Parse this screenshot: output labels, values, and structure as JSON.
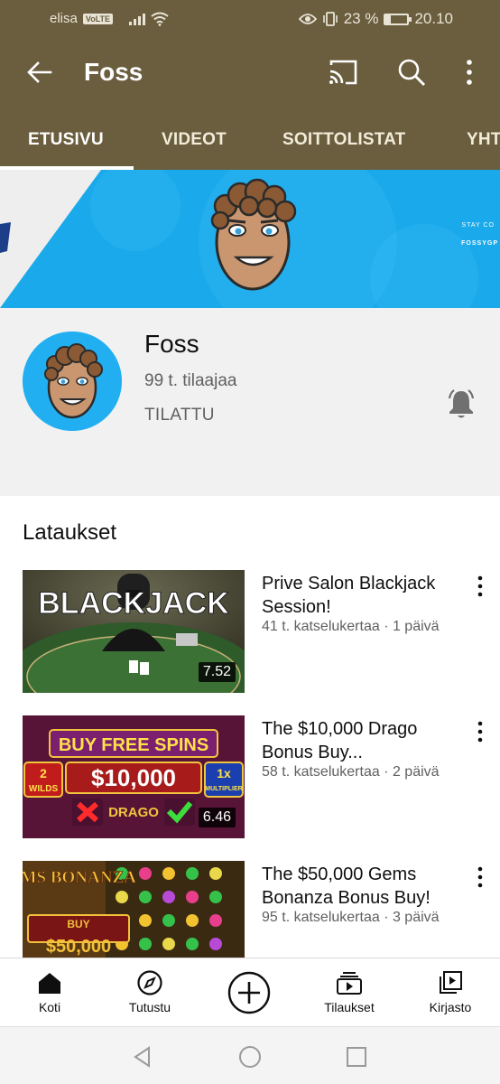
{
  "status_bar": {
    "carrier": "elisa",
    "volte": "VoLTE",
    "battery_text": "23 %",
    "battery_level": 0.23,
    "time": "20.10"
  },
  "app_bar": {
    "title": "Foss",
    "icons": [
      "arrow-back-icon",
      "cast-icon",
      "search-icon",
      "more-vert-icon"
    ]
  },
  "tabs": [
    {
      "label": "ETUSIVU",
      "active": true
    },
    {
      "label": "VIDEOT",
      "active": false
    },
    {
      "label": "SOITTOLISTAT",
      "active": false
    },
    {
      "label": "YHT",
      "active": false
    }
  ],
  "banner": {
    "text": "STAY CO",
    "handle": "FOSSYGP"
  },
  "channel": {
    "name": "Foss",
    "subscribers": "99 t. tilaajaa",
    "subscribed_label": "TILATTU"
  },
  "uploads": {
    "title": "Lataukset",
    "videos": [
      {
        "title": "Prive Salon Blackjack Session!",
        "meta": "41 t. katselukertaa · 1 päivä",
        "duration": "7.52",
        "thumb_text": "BLACKJACK"
      },
      {
        "title": "The $10,000 Drago Bonus Buy...",
        "meta": "58 t. katselukertaa · 2 päivä",
        "duration": "6.46",
        "thumb_text": "BUY FREE SPINS",
        "thumb_amount": "$10,000",
        "thumb_left_badge": "2 WILDS",
        "thumb_right_badge": "1x MULTIPLIER",
        "thumb_logo": "DRAGO"
      },
      {
        "title": "The $50,000 Gems Bonanza Bonus Buy!",
        "meta": "95 t. katselukertaa · 3 päivä",
        "duration": "",
        "thumb_text": "GEMS BONANZA",
        "thumb_buy": "BUY",
        "thumb_amount": "$50,000"
      }
    ]
  },
  "bottom_nav": {
    "items": [
      {
        "label": "Koti",
        "icon": "home-icon",
        "active": true
      },
      {
        "label": "Tutustu",
        "icon": "explore-icon",
        "active": false
      },
      {
        "label": "",
        "icon": "create-icon",
        "active": false
      },
      {
        "label": "Tilaukset",
        "icon": "subscriptions-icon",
        "active": false
      },
      {
        "label": "Kirjasto",
        "icon": "library-icon",
        "active": false
      }
    ]
  },
  "colors": {
    "app_bar": "#6b5e3f",
    "banner": "#19a8e8",
    "channel_header_bg": "#f1f1f1"
  }
}
